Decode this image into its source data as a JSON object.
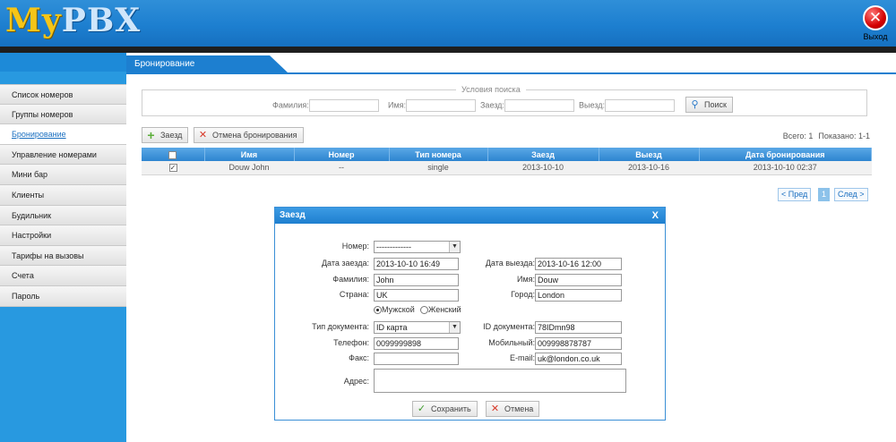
{
  "header": {
    "logo_my": "My",
    "logo_pbx": "PBX",
    "exit_label": "Выход",
    "exit_icon": "close-icon"
  },
  "sidebar": {
    "items": [
      {
        "label": "Список номеров"
      },
      {
        "label": "Группы номеров"
      },
      {
        "label": "Бронирование",
        "active": true
      },
      {
        "label": "Управление номерами"
      },
      {
        "label": "Мини бар"
      },
      {
        "label": "Клиенты"
      },
      {
        "label": "Будильник"
      },
      {
        "label": "Настройки"
      },
      {
        "label": "Тарифы на вызовы"
      },
      {
        "label": "Счета"
      },
      {
        "label": "Пароль"
      }
    ]
  },
  "page": {
    "title": "Бронирование"
  },
  "search": {
    "legend": "Условия поиска",
    "lastname_label": "Фамилия:",
    "firstname_label": "Имя:",
    "checkin_label": "Заезд:",
    "checkout_label": "Выезд:",
    "button": "Поиск"
  },
  "toolbar": {
    "checkin_button": "Заезд",
    "cancel_button": "Отмена бронирования"
  },
  "stats": {
    "total": "Всего: 1",
    "shown": "Показано: 1-1"
  },
  "table": {
    "headers": [
      "Имя",
      "Номер",
      "Тип номера",
      "Заезд",
      "Выезд",
      "Дата бронирования"
    ],
    "rows": [
      {
        "name": "Douw John",
        "room": "--",
        "type": "single",
        "checkin": "2013-10-10",
        "checkout": "2013-10-16",
        "booked": "2013-10-10 02:37",
        "checked": true
      }
    ]
  },
  "pager": {
    "prev": "< Пред",
    "current": "1",
    "next": "След >"
  },
  "dialog": {
    "title": "Заезд",
    "close": "X",
    "room_label": "Номер:",
    "room_value": "-------------",
    "checkin_label": "Дата заезда:",
    "checkin_value": "2013-10-10 16:49",
    "checkout_label": "Дата выезда:",
    "checkout_value": "2013-10-16 12:00",
    "lastname_label": "Фамилия:",
    "lastname_value": "John",
    "firstname_label": "Имя:",
    "firstname_value": "Douw",
    "country_label": "Страна:",
    "country_value": "UK",
    "city_label": "Город:",
    "city_value": "London",
    "gender_male": "Мужской",
    "gender_female": "Женский",
    "doctype_label": "Тип документа:",
    "doctype_value": "ID карта",
    "docid_label": "ID документа:",
    "docid_value": "78IDmn98",
    "phone_label": "Телефон:",
    "phone_value": "0099999898",
    "mobile_label": "Мобильный:",
    "mobile_value": "009998878787",
    "fax_label": "Факс:",
    "fax_value": "",
    "email_label": "E-mail:",
    "email_value": "uk@london.co.uk",
    "address_label": "Адрес:",
    "address_value": "",
    "save_button": "Сохранить",
    "cancel_button": "Отмена"
  }
}
